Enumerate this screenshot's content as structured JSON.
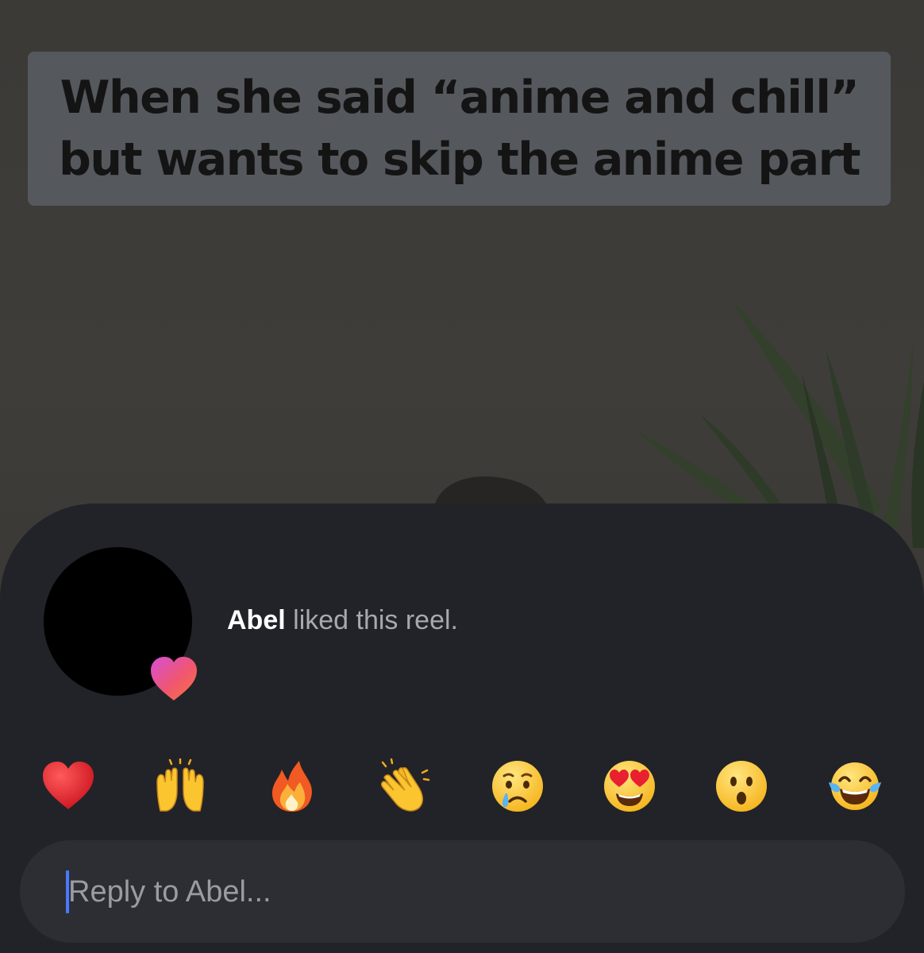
{
  "reel": {
    "caption_line_1": "When she said “anime and chill”",
    "caption_line_2": "but wants to skip the anime part"
  },
  "like_notice": {
    "user_name": "Abel",
    "action_text": " liked this reel."
  },
  "reactions": [
    {
      "name": "red-heart",
      "emoji": "❤️"
    },
    {
      "name": "raising-hands",
      "emoji": "🙌"
    },
    {
      "name": "fire",
      "emoji": "🔥"
    },
    {
      "name": "clapping-hands",
      "emoji": "👏"
    },
    {
      "name": "crying-face",
      "emoji": "😢"
    },
    {
      "name": "heart-eyes",
      "emoji": "😍"
    },
    {
      "name": "surprised-face",
      "emoji": "😮"
    },
    {
      "name": "tears-of-joy",
      "emoji": "😂"
    }
  ],
  "reply": {
    "placeholder": "Reply to Abel..."
  },
  "colors": {
    "sheet_background": "#222328",
    "reply_field": "#2c2e33",
    "caret": "#4a79ff",
    "muted_text": "#a7a9ae"
  }
}
